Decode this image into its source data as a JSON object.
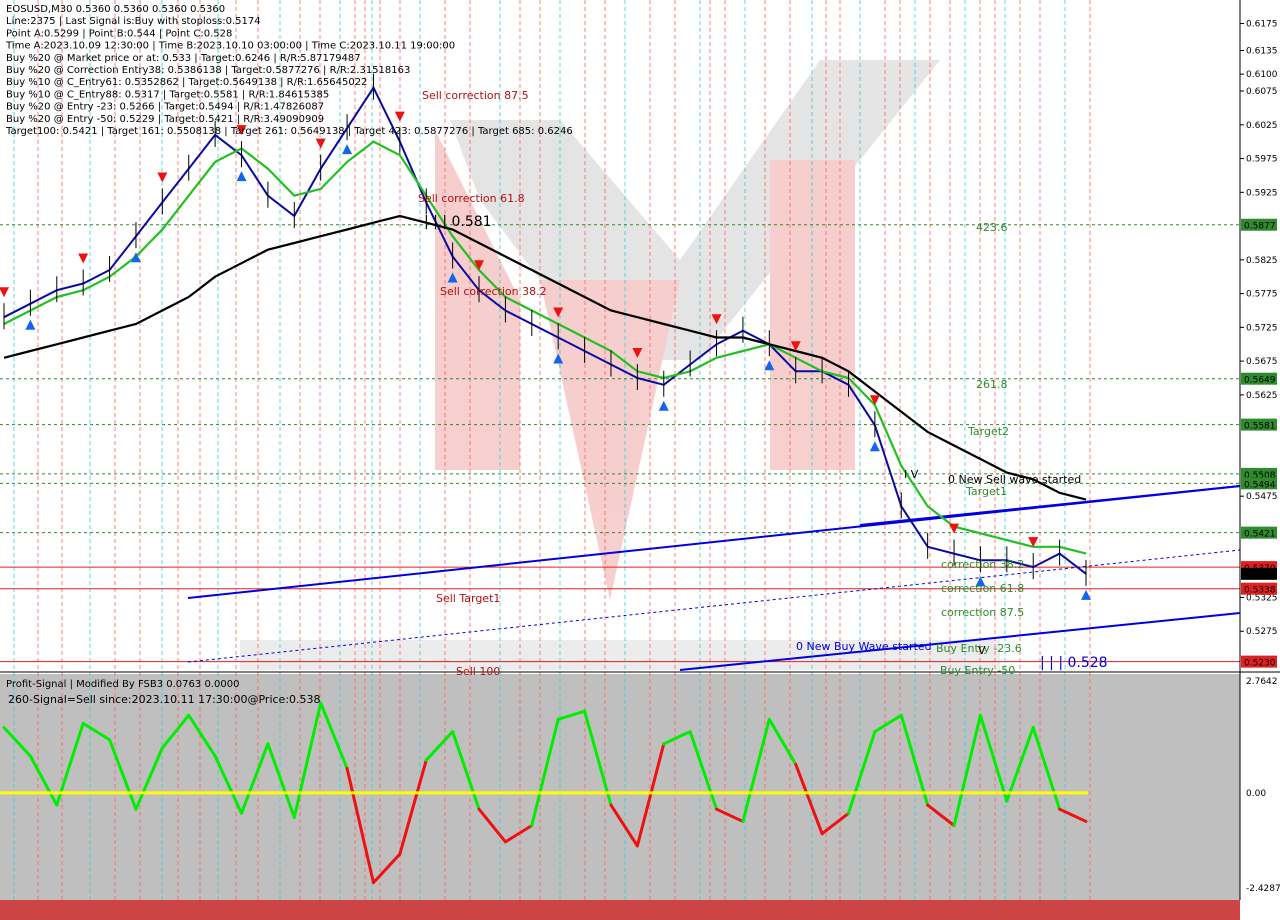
{
  "header": {
    "lines": [
      "EOSUSD,M30  0.5360 0.5360 0.5360 0.5360",
      "Line:2375  | Last Signal is:Buy with stoploss:0.5174",
      "Point A:0.5299  | Point B:0.544  | Point C:0.528",
      "Time A:2023.10.09 12:30:00  | Time B:2023.10.10 03:00:00  | Time C:2023.10.11 19:00:00",
      "Buy %20 @ Market price or at: 0.533  | Target:0.6246  | R/R:5.87179487",
      "Buy %20 @ Correction Entry38: 0.5386138  | Target:0.5877276  | R/R:2.31518163",
      "Buy %10 @ C_Entry61: 0.5352862  | Target:0.5649138  | R/R:1.65645022",
      "Buy %10 @ C_Entry88: 0.5317  | Target:0.5581  | R/R:1.84615385",
      "Buy %20 @ Entry -23: 0.5266  | Target:0.5494  | R/R:1.47826087",
      "Buy %20 @ Entry -50: 0.5229  | Target:0.5421  | R/R:3.49090909",
      "Target100: 0.5421  | Target 161: 0.5508138  | Target 261: 0.5649138  | Target 423: 0.5877276  | Target 685: 0.6246"
    ]
  },
  "annotations": {
    "sell_correction_875": "Sell correction 87.5",
    "sell_correction_618": "Sell correction 61.8",
    "sell_correction_382": "Sell correction 38.2",
    "sell_target1": "Sell Target1",
    "sell_100": "Sell 100",
    "level_0581": "| | | 0.581",
    "level_0528": "| | | 0.528",
    "t423": "423.6",
    "t261": "261.8",
    "target2": "Target2",
    "target1": "Target1",
    "iv": "I V",
    "new_sell_wave": "0 New Sell wave started",
    "new_buy_wave": "0 New Buy Wave started",
    "correction_382": "correction 38.2",
    "correction_618": "correction 61.8",
    "correction_875": "correction 87.5",
    "buy_entry": "Buy Entry -23.6",
    "v": "V",
    "buy_entry_50": "Buy Entry -50"
  },
  "price_axis": {
    "ticks": [
      "0.6175",
      "0.6135",
      "0.6100",
      "0.6075",
      "0.6025",
      "0.5975",
      "0.5925",
      "0.5825",
      "0.5775",
      "0.5725",
      "0.5675",
      "0.5625",
      "0.5475",
      "0.5325",
      "0.5275"
    ],
    "badges": [
      {
        "value": "0.5877",
        "bg": "#2e8b2e",
        "fg": "#ffffff"
      },
      {
        "value": "0.5649",
        "bg": "#2e8b2e",
        "fg": "#ffffff"
      },
      {
        "value": "0.5581",
        "bg": "#2e8b2e",
        "fg": "#ffffff"
      },
      {
        "value": "0.5508",
        "bg": "#2e8b2e",
        "fg": "#ffffff"
      },
      {
        "value": "0.5494",
        "bg": "#2e8b2e",
        "fg": "#ffffff"
      },
      {
        "value": "0.5421",
        "bg": "#2e8b2e",
        "fg": "#ffffff"
      },
      {
        "value": "0.5370",
        "bg": "#e02020",
        "fg": "#ffffff"
      },
      {
        "value": "0.5360",
        "bg": "#000000",
        "fg": "#ffffff"
      },
      {
        "value": "0.5338",
        "bg": "#e02020",
        "fg": "#ffffff"
      },
      {
        "value": "0.5230",
        "bg": "#e02020",
        "fg": "#ffffff"
      }
    ]
  },
  "osc": {
    "title": "Profit-Signal | Modified By FSB3 0.0763 0.0000",
    "signal": "260-Signal=Sell since:2023.10.11 17:30:00@Price:0.538",
    "ticks": [
      "2.7642",
      "0.00",
      "-2.4287"
    ]
  },
  "colors": {
    "ma_black": "#000000",
    "ma_green": "#22c022",
    "price_blue": "#0a0aa0",
    "channel_blue": "#0000e0",
    "osc_green": "#00ee00",
    "osc_red": "#ee1111",
    "zero_line": "#ffff00",
    "vline_red": "#ff6060",
    "vline_cyan": "#30d0d0",
    "target_green": "#2e8b2e"
  },
  "chart_data": {
    "type": "line",
    "symbol": "EOSUSD,M30",
    "ylim": [
      0.5225,
      0.6195
    ],
    "series": [
      {
        "name": "price",
        "values": [
          0.574,
          0.576,
          0.578,
          0.579,
          0.581,
          0.586,
          0.591,
          0.596,
          0.601,
          0.598,
          0.592,
          0.589,
          0.596,
          0.602,
          0.608,
          0.6,
          0.591,
          0.583,
          0.578,
          0.575,
          0.573,
          0.571,
          0.569,
          0.567,
          0.565,
          0.564,
          0.567,
          0.57,
          0.572,
          0.57,
          0.566,
          0.566,
          0.564,
          0.558,
          0.546,
          0.54,
          0.539,
          0.538,
          0.538,
          0.537,
          0.539,
          0.536
        ]
      },
      {
        "name": "green_ma",
        "values": [
          0.573,
          0.575,
          0.577,
          0.578,
          0.58,
          0.583,
          0.587,
          0.592,
          0.597,
          0.599,
          0.596,
          0.592,
          0.593,
          0.597,
          0.6,
          0.598,
          0.592,
          0.586,
          0.581,
          0.577,
          0.575,
          0.573,
          0.571,
          0.569,
          0.566,
          0.565,
          0.566,
          0.568,
          0.569,
          0.57,
          0.568,
          0.566,
          0.565,
          0.561,
          0.552,
          0.546,
          0.543,
          0.542,
          0.541,
          0.54,
          0.54,
          0.539
        ]
      },
      {
        "name": "black_ma",
        "values": [
          0.568,
          0.569,
          0.57,
          0.571,
          0.572,
          0.573,
          0.575,
          0.577,
          0.58,
          0.582,
          0.584,
          0.585,
          0.586,
          0.587,
          0.588,
          0.589,
          0.588,
          0.587,
          0.585,
          0.583,
          0.581,
          0.579,
          0.577,
          0.575,
          0.574,
          0.573,
          0.572,
          0.571,
          0.571,
          0.57,
          0.569,
          0.568,
          0.566,
          0.563,
          0.56,
          0.557,
          0.555,
          0.553,
          0.551,
          0.55,
          0.548,
          0.547
        ]
      }
    ],
    "levels": [
      {
        "value": 0.5877,
        "color": "#2e8b2e",
        "dash": true
      },
      {
        "value": 0.5649,
        "color": "#2e8b2e",
        "dash": true
      },
      {
        "value": 0.5581,
        "color": "#2e8b2e",
        "dash": true
      },
      {
        "value": 0.5508,
        "color": "#2e8b2e",
        "dash": true
      },
      {
        "value": 0.5494,
        "color": "#2e8b2e",
        "dash": true
      },
      {
        "value": 0.5421,
        "color": "#2e8b2e",
        "dash": true
      },
      {
        "value": 0.537,
        "color": "#e02020",
        "dash": false
      },
      {
        "value": 0.5338,
        "color": "#e02020",
        "dash": false
      },
      {
        "value": 0.523,
        "color": "#e02020",
        "dash": false
      }
    ],
    "oscillator": {
      "ylim": [
        -2.4287,
        2.7642
      ],
      "values": [
        1.6,
        0.9,
        -0.3,
        1.7,
        1.3,
        -0.4,
        1.1,
        1.9,
        0.9,
        -0.5,
        1.2,
        -0.6,
        2.2,
        0.6,
        -2.2,
        -1.5,
        0.8,
        1.5,
        -0.4,
        -1.2,
        -0.8,
        1.8,
        2.0,
        -0.3,
        -1.3,
        1.2,
        1.5,
        -0.4,
        -0.7,
        1.8,
        0.7,
        -1.0,
        -0.5,
        1.5,
        1.9,
        -0.3,
        -0.8,
        1.9,
        -0.2,
        1.6,
        -0.4,
        -0.7
      ]
    }
  }
}
